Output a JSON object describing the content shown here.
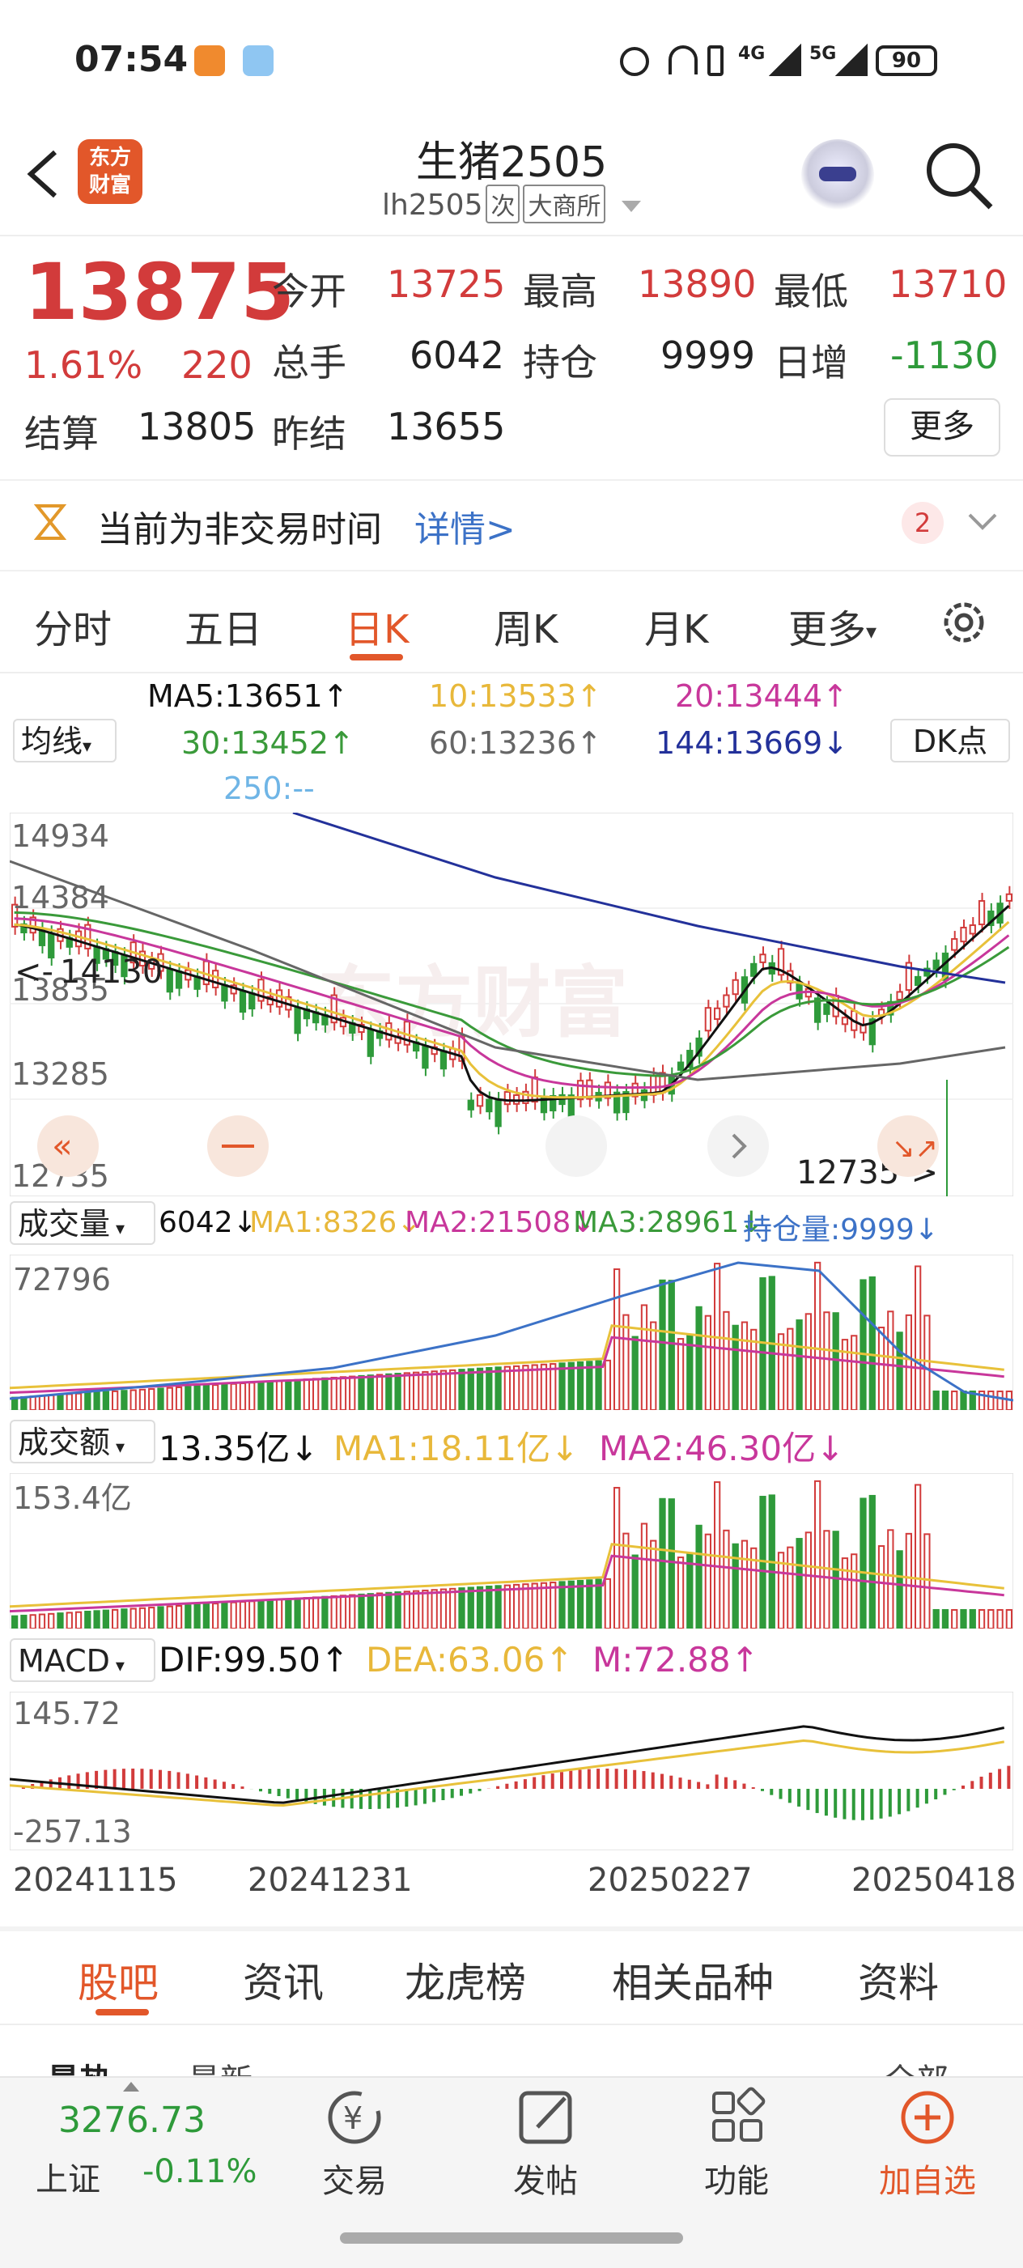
{
  "status": {
    "time": "07:54",
    "net1": "4G",
    "net2": "5G",
    "battery": "90"
  },
  "header": {
    "title": "生猪2505",
    "code": "lh2505",
    "tag1": "次",
    "tag2": "大商所",
    "logo_text_1": "东方",
    "logo_text_2": "财富"
  },
  "quote": {
    "price": "13875",
    "change_pct": "1.61%",
    "change": "220",
    "open_label": "今开",
    "open": "13725",
    "high_label": "最高",
    "high": "13890",
    "low_label": "最低",
    "low": "13710",
    "volume_label": "总手",
    "volume": "6042",
    "oi_label": "持仓",
    "oi": "9999",
    "daily_label": "日增",
    "daily": "-1130",
    "settle_label": "结算",
    "settle": "13805",
    "prev_settle_label": "昨结",
    "prev_settle": "13655",
    "more_button": "更多"
  },
  "notice": {
    "text": "当前为非交易时间",
    "link": "详情>",
    "count": "2"
  },
  "tabs": [
    "分时",
    "五日",
    "日K",
    "周K",
    "月K",
    "更多"
  ],
  "ma": {
    "select": "均线",
    "ma5": "MA5:13651↑",
    "ma10": "10:13533↑",
    "ma20": "20:13444↑",
    "ma30": "30:13452↑",
    "ma60": "60:13236↑",
    "ma144": "144:13669↓",
    "ma250": "250:--",
    "dk": "DK点"
  },
  "kline": {
    "y_labels": [
      "14934",
      "14384",
      "13835",
      "13285",
      "12735"
    ],
    "high_mark": "14130",
    "low_mark": "12735->",
    "watermark": "东方财富"
  },
  "volume_panel": {
    "select": "成交量",
    "value": "6042↓",
    "ma1": "MA1:8326↓",
    "ma2": "MA2:21508↓",
    "ma3": "MA3:28961↓",
    "oi": "持仓量:9999↓",
    "max": "72796"
  },
  "amount_panel": {
    "select": "成交额",
    "value": "13.35亿↓",
    "ma1": "MA1:18.11亿↓",
    "ma2": "MA2:46.30亿↓",
    "max": "153.4亿"
  },
  "macd_panel": {
    "select": "MACD",
    "dif": "DIF:99.50↑",
    "dea": "DEA:63.06↑",
    "m": "M:72.88↑",
    "top": "145.72",
    "bottom": "-257.13"
  },
  "dates": [
    "20241115",
    "20241231",
    "20250227",
    "20250418"
  ],
  "subtabs": [
    "股吧",
    "资讯",
    "龙虎榜",
    "相关品种",
    "资料"
  ],
  "partial": [
    "最热",
    "最新",
    "全部"
  ],
  "bottom": {
    "index_value": "3276.73",
    "index_name": "上证",
    "index_change": "-0.11%",
    "trade": "交易",
    "post": "发帖",
    "func": "功能",
    "watch": "加自选"
  },
  "colors": {
    "up": "#d23b3b",
    "down": "#2e9a3a",
    "accent": "#e2572a",
    "ma5": "#111111",
    "ma10": "#e8c13a",
    "ma20": "#c8379b",
    "ma30": "#3a9a3a",
    "ma60": "#666666",
    "ma144": "#23319a",
    "ma250": "#6fb5e6"
  }
}
